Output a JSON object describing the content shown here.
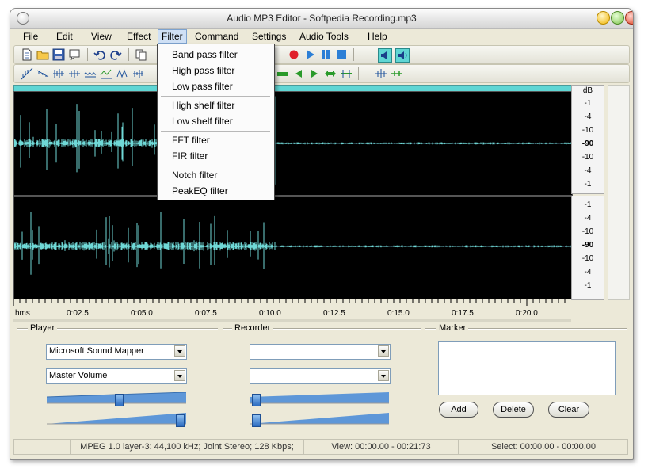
{
  "window": {
    "title": "Audio MP3 Editor - Softpedia Recording.mp3"
  },
  "menubar": {
    "items": [
      "File",
      "Edit",
      "View",
      "Effect",
      "Filter",
      "Command",
      "Settings",
      "Audio Tools",
      "Help"
    ],
    "active": "Filter"
  },
  "filter_menu": {
    "items": [
      "Band pass filter",
      "High pass filter",
      "Low pass filter",
      "High shelf filter",
      "Low shelf filter",
      "FFT filter",
      "FIR filter",
      "Notch filter",
      "PeakEQ filter"
    ]
  },
  "db_scale": {
    "unit": "dB",
    "channel1": [
      "-1",
      "-4",
      "-10",
      "-90",
      "-10",
      "-4",
      "-1"
    ],
    "channel2": [
      "-1",
      "-4",
      "-10",
      "-90",
      "-10",
      "-4",
      "-1"
    ]
  },
  "timeline": {
    "labels": [
      "hms",
      "0:02.5",
      "0:05.0",
      "0:07.5",
      "0:10.0",
      "0:12.5",
      "0:15.0",
      "0:17.5",
      "0:20.0"
    ]
  },
  "player": {
    "label": "Player",
    "device": "Microsoft Sound Mapper",
    "volume_source": "Master Volume",
    "slider1_level": 0.52,
    "slider2_level": 0.98
  },
  "recorder": {
    "label": "Recorder",
    "device": "",
    "source": "",
    "slider1_level": 0.02,
    "slider2_level": 0.02
  },
  "marker": {
    "label": "Marker",
    "add": "Add",
    "delete": "Delete",
    "clear": "Clear"
  },
  "status": {
    "format": "MPEG 1.0 layer-3: 44,100 kHz; Joint Stereo; 128 Kbps;",
    "view": "View: 00:00.00 - 00:21:73",
    "select": "Select: 00:00.00 - 00:00.00"
  },
  "colors": {
    "waveform": "#6fd8d6",
    "track_header": "#5fd6d4",
    "record": "#e0202a",
    "play": "#2c7fd6"
  }
}
